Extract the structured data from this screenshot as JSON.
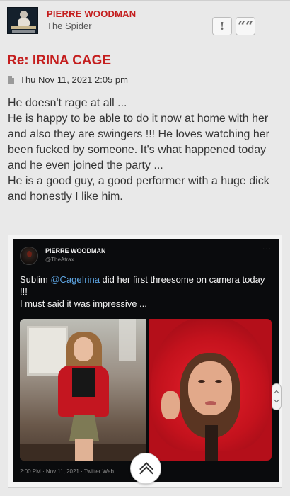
{
  "author": {
    "name": "PIERRE WOODMAN",
    "rank": "The Spider",
    "avatar_icon": "spider-skull-avatar"
  },
  "actions": {
    "report_label": "!",
    "quote_label": "““"
  },
  "post": {
    "title": "Re: IRINA CAGE",
    "date": "Thu Nov 11, 2021 2:05 pm",
    "body": [
      "He doesn't rage at all ...",
      "He is happy to be able to do it now at home with her and also they are swingers !!! He loves watching her been fucked by someone. It's what happened today and he even joined the party ...",
      "He is a good guy, a good performer with a huge dick and honestly I like him."
    ]
  },
  "tweet": {
    "name": "PIERRE WOODMAN",
    "handle": "@TheAtrax",
    "more": "···",
    "text_pre": "Sublim ",
    "mention": "@CageIrina",
    "text_post": " did her first threesome on camera today !!!",
    "text_line2": "I must said it was impressive ...",
    "footer": "2:00 PM · Nov 11, 2021 · Twitter Web",
    "mention_color": "#5fa8e6"
  },
  "colors": {
    "accent": "#c41e1e",
    "background": "#e9e9e9"
  }
}
